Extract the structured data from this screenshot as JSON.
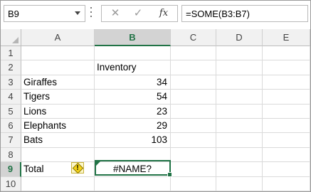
{
  "formula_bar": {
    "name_box": "B9",
    "formula": "=SOME(B3:B7)",
    "fx_label": "fx",
    "cancel_glyph": "✕",
    "enter_glyph": "✓"
  },
  "columns": [
    "A",
    "B",
    "C",
    "D",
    "E"
  ],
  "selected_column": "B",
  "rows": [
    "1",
    "2",
    "3",
    "4",
    "5",
    "6",
    "7",
    "8",
    "9",
    "10"
  ],
  "selected_row": "9",
  "cells": {
    "B2": "Inventory",
    "A3": "Giraffes",
    "B3": "34",
    "A4": "Tigers",
    "B4": "54",
    "A5": "Lions",
    "B5": "23",
    "A6": "Elephants",
    "B6": "29",
    "A7": "Bats",
    "B7": "103",
    "A9": "Total",
    "B9": "#NAME?"
  },
  "error_indicator": {
    "icon": "warning-icon",
    "glyph": "!"
  },
  "colors": {
    "accent": "#217346",
    "header_bg": "#f1f1f1",
    "selected_header_bg": "#d3d3d3"
  }
}
